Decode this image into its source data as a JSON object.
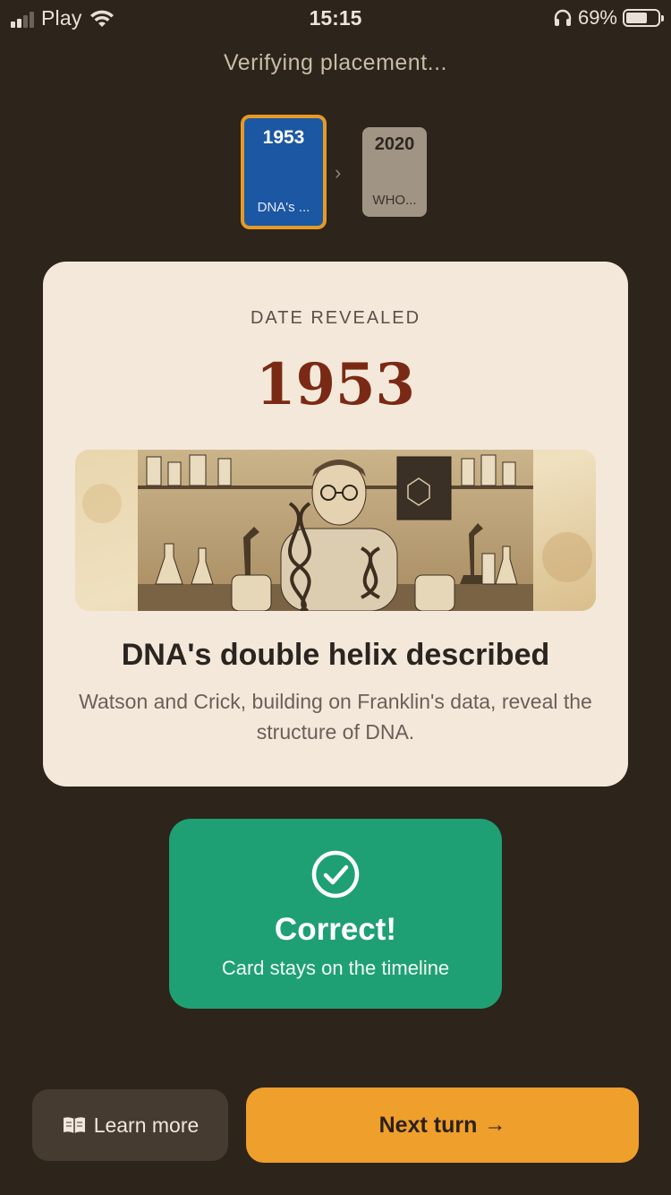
{
  "status_bar": {
    "carrier": "Play",
    "time": "15:15",
    "battery_percent": "69%",
    "battery_level": 0.69
  },
  "status_message": "Verifying placement...",
  "mini_timeline": [
    {
      "year": "1953",
      "title": "DNA's ...",
      "active": true
    },
    {
      "year": "2020",
      "title": "WHO...",
      "active": false
    }
  ],
  "reveal_card": {
    "label": "DATE REVEALED",
    "year": "1953",
    "illustration_icon": "scientist-with-dna-model-illustration",
    "title": "DNA's double helix described",
    "description": "Watson and Crick, building on Franklin's data, reveal the structure of DNA."
  },
  "result": {
    "icon": "check-circle-icon",
    "title": "Correct!",
    "subtitle": "Card stays on the timeline",
    "color": "#1fa074"
  },
  "actions": {
    "learn_more": "Learn more",
    "learn_more_icon": "book-icon",
    "next_turn": "Next turn",
    "next_turn_icon": "→"
  },
  "colors": {
    "background": "#2d241b",
    "accent": "#ef9f2b",
    "card": "#f3e8da",
    "year_text": "#7a2a14",
    "active_card": "#1b57a3"
  }
}
